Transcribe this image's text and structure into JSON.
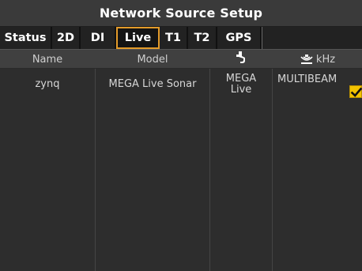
{
  "window": {
    "title": "Network Source Setup"
  },
  "tabs": [
    {
      "label": "Status",
      "active": false
    },
    {
      "label": "2D",
      "active": false
    },
    {
      "label": "DI",
      "active": false
    },
    {
      "label": "Live",
      "active": true
    },
    {
      "label": "T1",
      "active": false
    },
    {
      "label": "T2",
      "active": false
    },
    {
      "label": "GPS",
      "active": false
    }
  ],
  "table": {
    "headers": {
      "name": "Name",
      "model": "Model",
      "transducer_icon": "transducer-icon",
      "khz_icon": "sonar-beam-icon",
      "khz": "kHz"
    },
    "rows": [
      {
        "name": "zynq",
        "model": "MEGA Live Sonar",
        "transducer_line1": "MEGA",
        "transducer_line2": "Live",
        "frequency": "MULTIBEAM",
        "selected": true
      }
    ]
  },
  "colors": {
    "accent": "#e39b2a",
    "checkbox": "#f2c200",
    "background": "#2d2d2d",
    "header": "#404040"
  }
}
